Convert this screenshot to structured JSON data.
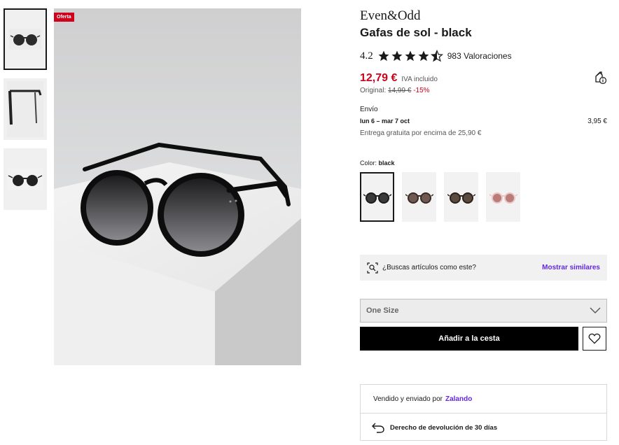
{
  "gallery": {
    "badge": "Oferta",
    "thumbnails": [
      {
        "icon": "sunglasses-front-thumbnail",
        "selected": true
      },
      {
        "icon": "sunglasses-side-thumbnail",
        "selected": false
      },
      {
        "icon": "sunglasses-flat-thumbnail",
        "selected": false
      }
    ]
  },
  "product": {
    "brand": "Even&Odd",
    "title": "Gafas de sol - black",
    "rating_value": "4.2",
    "rating_stars": 4.2,
    "rating_count": "983 Valoraciones"
  },
  "price": {
    "current": "12,79 €",
    "vat": "IVA incluido",
    "original_label": "Original:",
    "original": "14,99 €",
    "discount": "-15%"
  },
  "shipping": {
    "label": "Envío",
    "dates": "lun 6 – mar 7 oct",
    "cost": "3,95 €",
    "free_note": "Entrega gratuita por encima de 25,90 €"
  },
  "color": {
    "label": "Color:",
    "selected_name": "black",
    "swatches": [
      {
        "name": "black",
        "frame": "#1b1b1b",
        "lens": "#3a3a3a",
        "selected": true
      },
      {
        "name": "brown",
        "frame": "#3b2a24",
        "lens": "#6e5a52",
        "selected": false
      },
      {
        "name": "tortoise",
        "frame": "#2d1f19",
        "lens": "#5a4a3f",
        "selected": false
      },
      {
        "name": "pink",
        "frame": "#e9c7c4",
        "lens": "#b97c79",
        "selected": false
      }
    ]
  },
  "similar": {
    "question": "¿Buscas artículos como este?",
    "link": "Mostrar similares"
  },
  "size": {
    "value": "One Size"
  },
  "actions": {
    "add_to_cart": "Añadir a la cesta"
  },
  "seller": {
    "text": "Vendido y enviado por",
    "name": "Zalando",
    "returns": "Derecho de devolución de 30 días"
  },
  "colors": {
    "accent_red": "#d0021b",
    "link_purple": "#6328e0"
  }
}
